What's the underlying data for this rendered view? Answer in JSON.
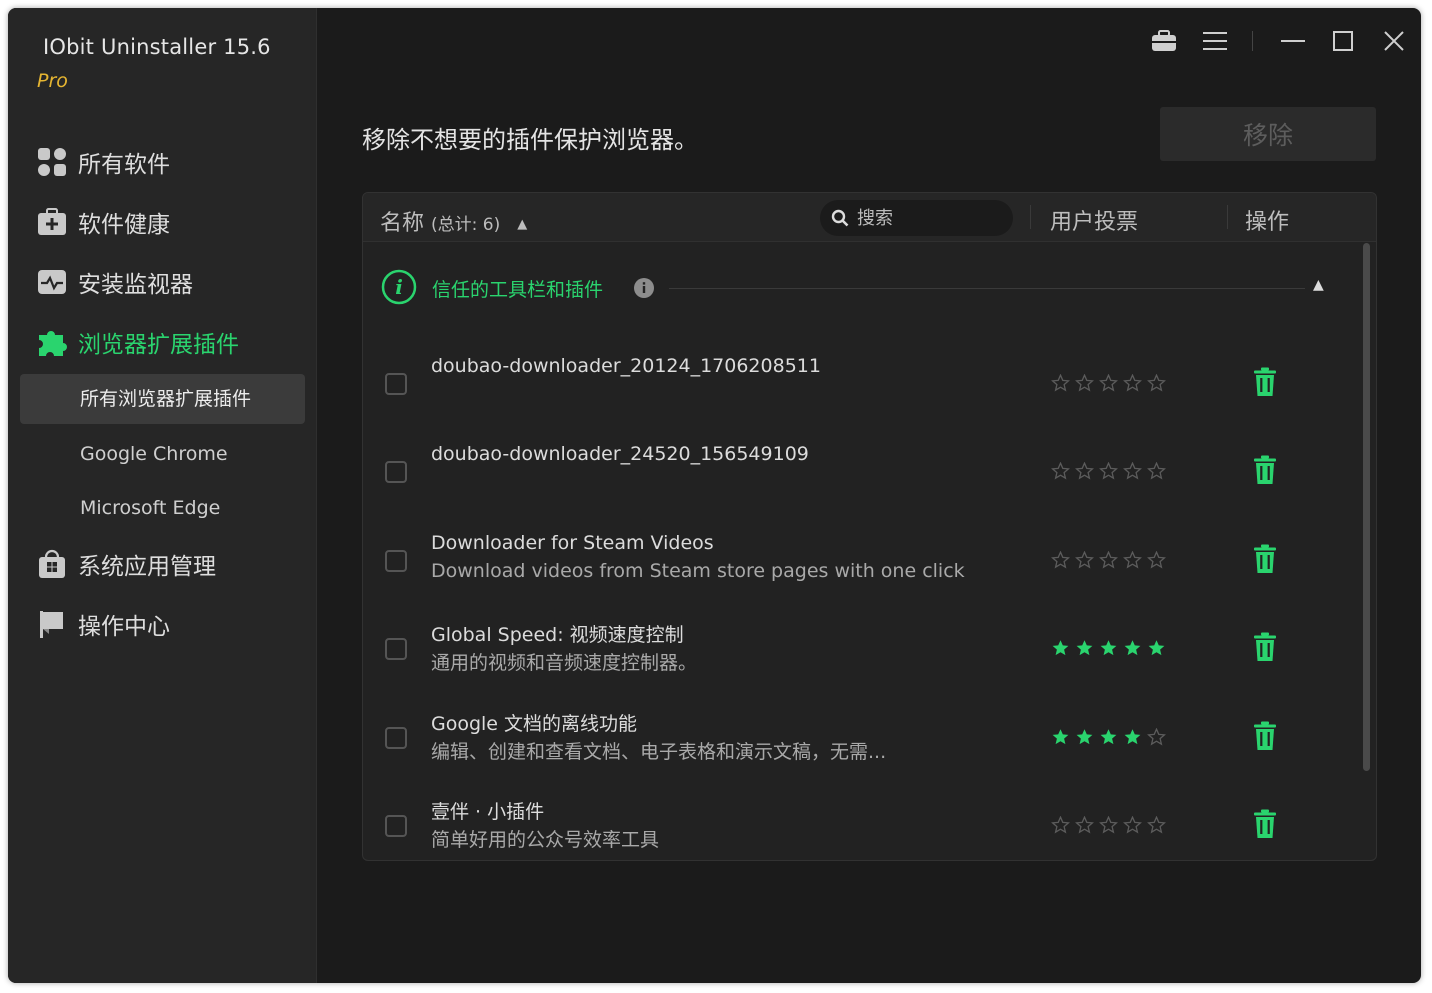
{
  "app": {
    "title": "IObit Uninstaller 15.6",
    "edition": "Pro"
  },
  "sidebar": {
    "items": [
      {
        "label": "所有软件",
        "icon": "grid-apps-icon"
      },
      {
        "label": "软件健康",
        "icon": "health-kit-icon"
      },
      {
        "label": "安装监视器",
        "icon": "monitor-icon"
      },
      {
        "label": "浏览器扩展插件",
        "icon": "puzzle-icon"
      },
      {
        "label": "系统应用管理",
        "icon": "windows-store-icon"
      },
      {
        "label": "操作中心",
        "icon": "flag-icon"
      }
    ],
    "subitems": [
      {
        "label": "所有浏览器扩展插件"
      },
      {
        "label": "Google Chrome"
      },
      {
        "label": "Microsoft Edge"
      }
    ]
  },
  "titlebar": {
    "icons": [
      "toolbox-icon",
      "menu-icon",
      "minimize-icon",
      "maximize-icon",
      "close-icon"
    ]
  },
  "main": {
    "heading": "移除不想要的插件保护浏览器。",
    "remove_button": "移除",
    "table": {
      "col_name": "名称",
      "col_count": "(总计: 6)",
      "search_placeholder": "搜索",
      "col_votes": "用户投票",
      "col_actions": "操作"
    },
    "group": {
      "label": "信任的工具栏和插件"
    },
    "rows": [
      {
        "name": "doubao-downloader_20124_1706208511",
        "desc": "",
        "rating": 0
      },
      {
        "name": "doubao-downloader_24520_156549109",
        "desc": "",
        "rating": 0
      },
      {
        "name": "Downloader for Steam Videos",
        "desc": "Download videos from Steam store pages with one click",
        "rating": 0
      },
      {
        "name": "Global Speed: 视频速度控制",
        "desc": "通用的视频和音频速度控制器。",
        "rating": 5
      },
      {
        "name": "Google 文档的离线功能",
        "desc": "编辑、创建和查看文档、电子表格和演示文稿，无需...",
        "rating": 4
      },
      {
        "name": "壹伴 · 小插件",
        "desc": "简单好用的公众号效率工具",
        "rating": 0
      }
    ]
  },
  "colors": {
    "accent": "#2ad46e",
    "edition": "#e5b531",
    "background": "#1b1b1b",
    "sidebar": "#262626"
  }
}
